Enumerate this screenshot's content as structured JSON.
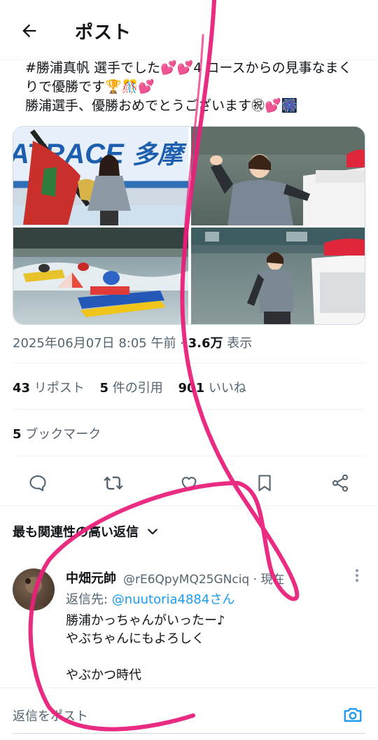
{
  "header": {
    "title": "ポスト"
  },
  "post": {
    "line1": "#勝浦真帆 選手でした💕💕4 コースからの見事なまく",
    "line2": "りで優勝です🏆🎊💕",
    "line3": "勝浦選手、優勝おめでとうございます㊗💕🎆",
    "timestamp": "2025年06月07日 8:05 午前",
    "views_count": "3.6万",
    "views_label": "表示"
  },
  "stats": {
    "reposts_count": "43",
    "reposts_label": "リポスト",
    "quotes_count": "5",
    "quotes_label": "件の引用",
    "likes_count": "901",
    "likes_label": "いいね",
    "bookmarks_count": "5",
    "bookmarks_label": "ブックマーク"
  },
  "sort": {
    "label": "最も関連性の高い返信"
  },
  "reply": {
    "name": "中畑元帥",
    "handle": "@rE6QpyMQ25GNciq · 現在",
    "reply_to_label": "返信先: ",
    "reply_to_user": "@nuutoria4884さん",
    "body": "勝浦かっちゃんがいったー♪\nやぶちゃんにもよろしく\n\n やぶかつ時代"
  },
  "composer": {
    "placeholder": "返信をポスト"
  },
  "colors": {
    "accent": "#1d9bf0",
    "scribble": "#e8207a"
  }
}
